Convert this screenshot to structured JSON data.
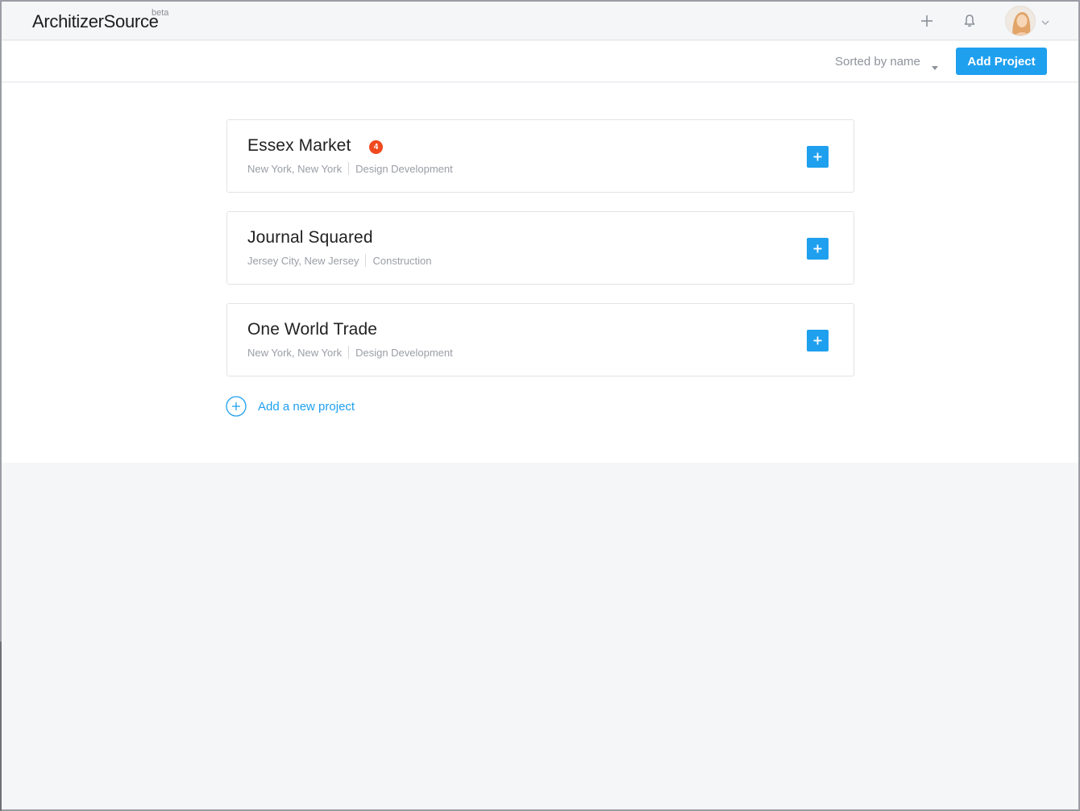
{
  "app": {
    "logo_text": "ArchitizerSource",
    "logo_badge": "beta"
  },
  "header": {
    "icons": [
      "plus-icon",
      "bell-icon",
      "chevron-down-icon"
    ],
    "avatar": "user-avatar"
  },
  "toolbar": {
    "sort_label": "Sorted by name",
    "add_project_label": "Add Project"
  },
  "projects": [
    {
      "name": "Essex Market",
      "badge": "4",
      "location": "New York, New York",
      "phase": "Design Development"
    },
    {
      "name": "Journal Squared",
      "badge": "",
      "location": "Jersey City, New Jersey",
      "phase": "Construction"
    },
    {
      "name": "One World Trade",
      "badge": "",
      "location": "New York, New York",
      "phase": "Design Development"
    }
  ],
  "add_new_project_label": "Add a new project",
  "colors": {
    "accent": "#1fa0ef",
    "badge": "#f0491f",
    "text": "#222222",
    "muted": "#9a9ea5"
  }
}
